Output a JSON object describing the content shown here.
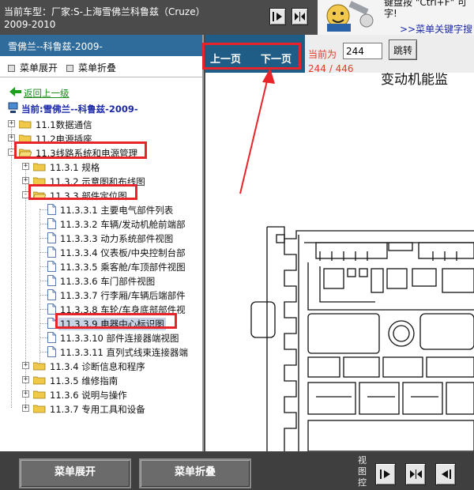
{
  "header": {
    "title_line1": "当前车型：厂家:S-上海雪佛兰科鲁兹（Cruze）",
    "title_line2": "2009-2010",
    "hint_text": "键盘按 \"Ctrl+F\" 可\n字!",
    "hint_link": ">>菜单关键字搜"
  },
  "left": {
    "header": "雪佛兰--科鲁兹-2009-",
    "expand_label": "菜单展开",
    "collapse_label": "菜单折叠",
    "back_label": "返回上一级",
    "current_label": "当前:雪佛兰--科鲁兹-2009-"
  },
  "tree": [
    {
      "label": "11.1数据通信",
      "kind": "folder",
      "level": 0,
      "expander": "+"
    },
    {
      "label": "11.2电源插座",
      "kind": "folder",
      "level": 0,
      "expander": "+"
    },
    {
      "label": "11.3线路系统和电源管理",
      "kind": "folder-open",
      "level": 0,
      "expander": "-"
    },
    {
      "label": "11.3.1 规格",
      "kind": "folder",
      "level": 1,
      "expander": "+"
    },
    {
      "label": "11.3.2 示意图和布线图",
      "kind": "folder",
      "level": 1,
      "expander": "+"
    },
    {
      "label": "11.3.3 部件定位图",
      "kind": "folder-open",
      "level": 1,
      "expander": "-"
    },
    {
      "label": "11.3.3.1 主要电气部件列表",
      "kind": "doc",
      "level": 2
    },
    {
      "label": "11.3.3.2 车辆/发动机舱前端部",
      "kind": "doc",
      "level": 2
    },
    {
      "label": "11.3.3.3 动力系统部件视图",
      "kind": "doc",
      "level": 2
    },
    {
      "label": "11.3.3.4 仪表板/中央控制台部",
      "kind": "doc",
      "level": 2
    },
    {
      "label": "11.3.3.5 乘客舱/车顶部件视图",
      "kind": "doc",
      "level": 2
    },
    {
      "label": "11.3.3.6 车门部件视图",
      "kind": "doc",
      "level": 2
    },
    {
      "label": "11.3.3.7 行李厢/车辆后端部件",
      "kind": "doc",
      "level": 2
    },
    {
      "label": "11.3.3.8 车轮/车身底部部件视",
      "kind": "doc",
      "level": 2
    },
    {
      "label": "11.3.3.9 电器中心标识图",
      "kind": "doc",
      "level": 2,
      "selected": true
    },
    {
      "label": "11.3.3.10 部件连接器端视图",
      "kind": "doc",
      "level": 2
    },
    {
      "label": "11.3.3.11 直列式线束连接器端",
      "kind": "doc",
      "level": 2
    },
    {
      "label": "11.3.4 诊断信息和程序",
      "kind": "folder",
      "level": 1,
      "expander": "+"
    },
    {
      "label": "11.3.5 维修指南",
      "kind": "folder",
      "level": 1,
      "expander": "+"
    },
    {
      "label": "11.3.6 说明与操作",
      "kind": "folder",
      "level": 1,
      "expander": "+"
    },
    {
      "label": "11.3.7 专用工具和设备",
      "kind": "folder",
      "level": 1,
      "expander": "+"
    }
  ],
  "nav": {
    "prev_label": "上一页",
    "next_label": "下一页",
    "current_label": "当前为",
    "page_value": "244",
    "jump_label": "跳转",
    "page_count": "244 / 446",
    "doc_heading": "变动机能监"
  },
  "bottom": {
    "expand_label": "菜单展开",
    "collapse_label": "菜单折叠",
    "view_control_label": "视\n图\n控"
  },
  "colors": {
    "header_blue": "#2f6c9c",
    "nav_blue": "#1f5c86",
    "highlight_red": "#e8242b",
    "page_red": "#e53b2a",
    "link_green": "#1a8a1a"
  }
}
